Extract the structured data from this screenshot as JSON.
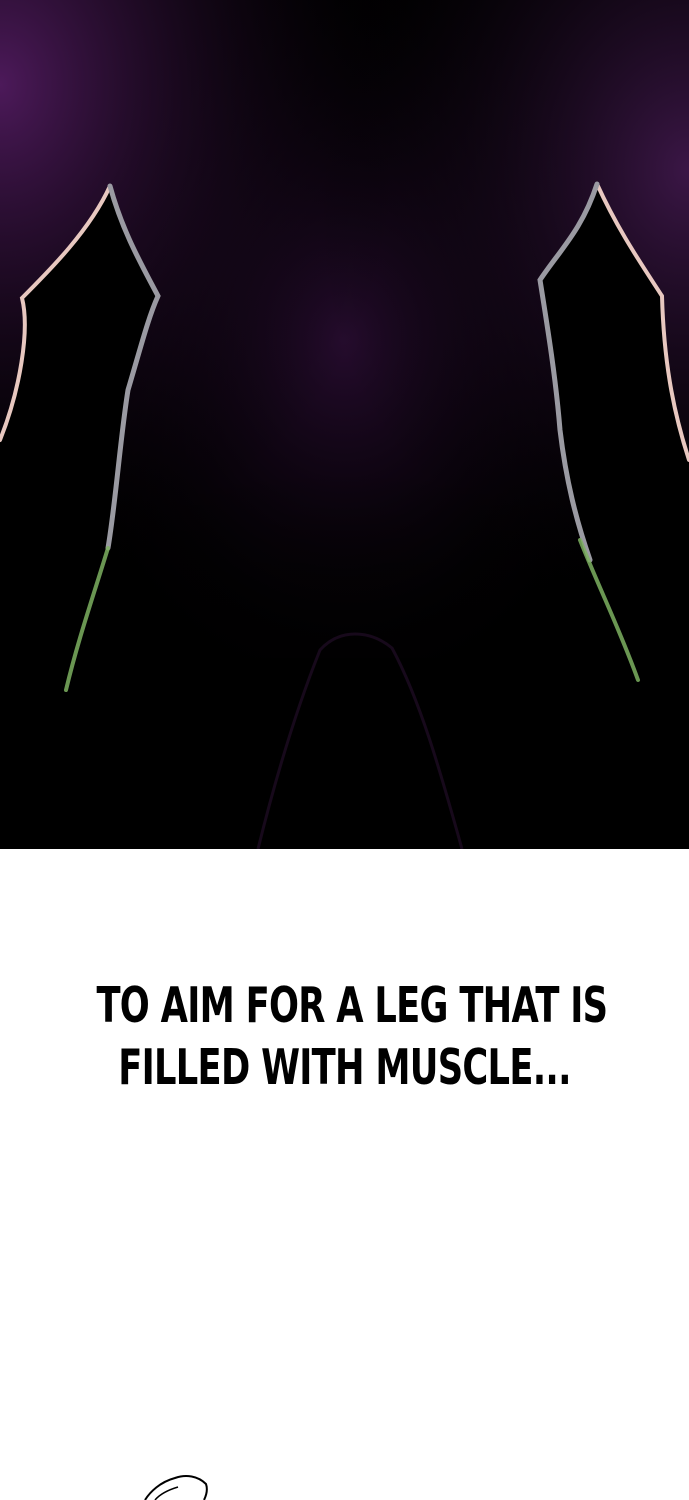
{
  "caption": {
    "line1": "TO AIM FOR A LEG THAT IS",
    "line2": "FILLED WITH MUSCLE..."
  },
  "colors": {
    "background": "#000000",
    "glow": "#5a1e6a",
    "rim_highlight": "#e8c8c0",
    "rim_shadow": "#9a9aa2",
    "rim_green": "#7cb060",
    "caption_text": "#000000",
    "page_bg": "#ffffff"
  }
}
